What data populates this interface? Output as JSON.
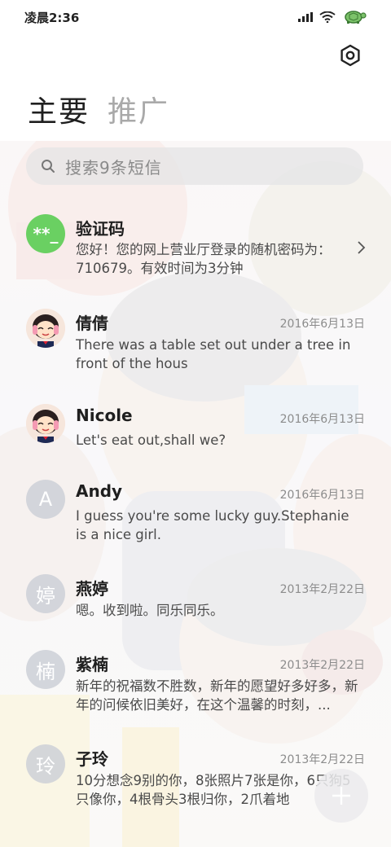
{
  "status_bar": {
    "time": "凌晨2:36"
  },
  "tabs": [
    {
      "label": "主要"
    },
    {
      "label": "推广"
    }
  ],
  "search": {
    "placeholder": "搜索9条短信"
  },
  "conversations": [
    {
      "name": "验证码",
      "avatar_text": "**_",
      "date": "",
      "preview": "您好！您的网上营业厅登录的随机密码为：710679。有效时间为3分钟"
    },
    {
      "name": "倩倩",
      "avatar_text": "",
      "date": "2016年6月13日",
      "preview": "There was a table set out under a tree in front of the hous"
    },
    {
      "name": "Nicole",
      "avatar_text": "",
      "date": "2016年6月13日",
      "preview": "Let's eat out,shall we?"
    },
    {
      "name": "Andy",
      "avatar_text": "A",
      "date": "2016年6月13日",
      "preview": "I guess you're some lucky guy.Stephanie is a nice girl."
    },
    {
      "name": "燕婷",
      "avatar_text": "婷",
      "date": "2013年2月22日",
      "preview": "嗯。收到啦。同乐同乐。"
    },
    {
      "name": "紫楠",
      "avatar_text": "楠",
      "date": "2013年2月22日",
      "preview": "新年的祝福数不胜数，新年的愿望好多好多，新年的问候依旧美好，在这个温馨的时刻，..."
    },
    {
      "name": "子玲",
      "avatar_text": "玲",
      "date": "2013年2月22日",
      "preview": "10分想念9别的你，8张照片7张是你，6只狗5只像你，4根骨头3根归你，2爪着地"
    }
  ],
  "colors": {
    "verification_avatar": "#6ad062",
    "letter_avatar": "#cdd0d7"
  },
  "icons": {
    "settings": "settings-icon",
    "search": "search-icon",
    "compose": "plus-icon"
  }
}
